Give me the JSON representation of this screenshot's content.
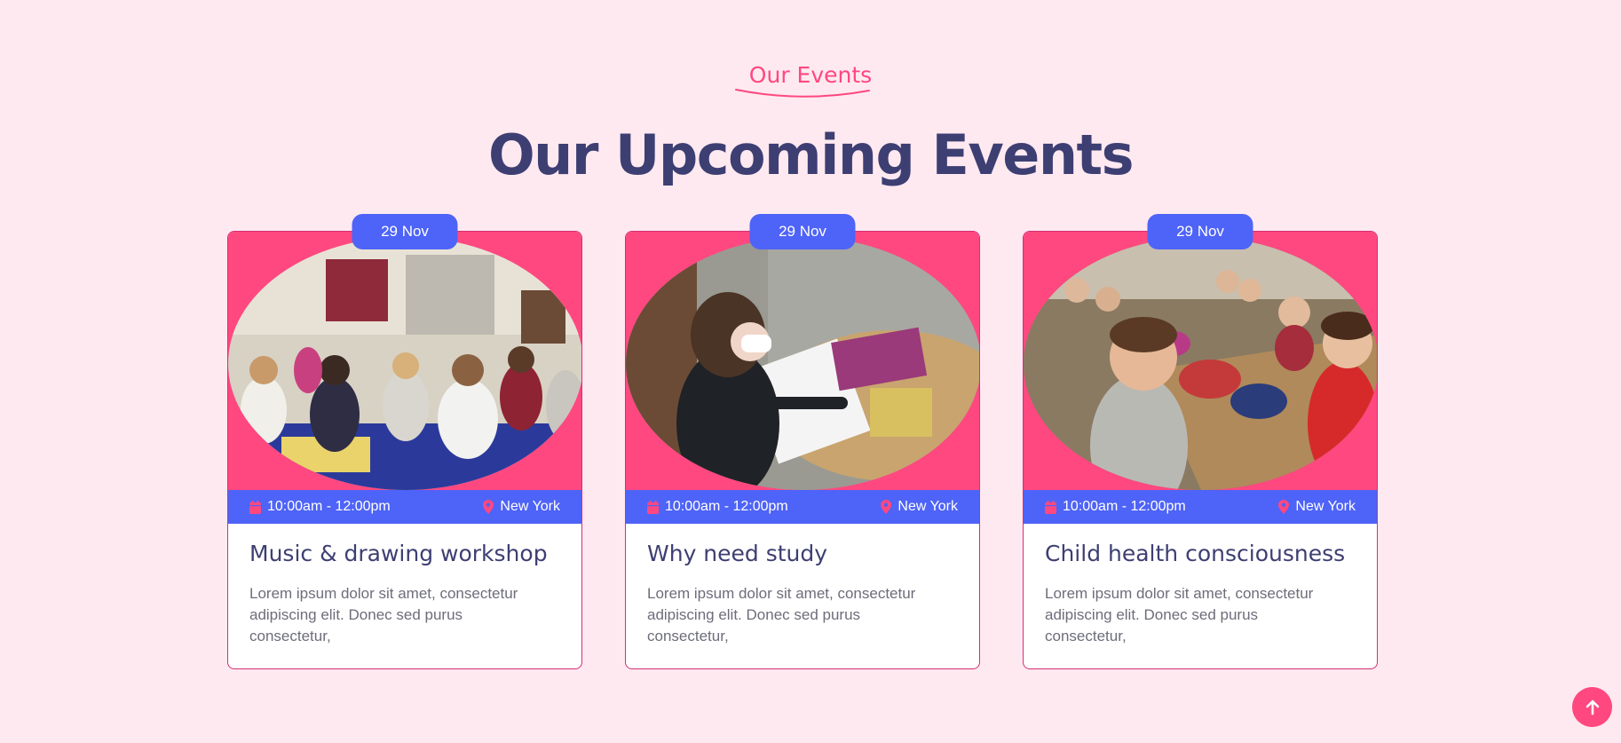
{
  "header": {
    "tag": "Our Events",
    "title": "Our Upcoming Events"
  },
  "events": [
    {
      "date": "29 Nov",
      "time": "10:00am - 12:00pm",
      "location": "New York",
      "title": "Music & drawing workshop",
      "description": "Lorem ipsum dolor sit amet, consectetur adipiscing elit. Donec sed purus consectetur,"
    },
    {
      "date": "29 Nov",
      "time": "10:00am - 12:00pm",
      "location": "New York",
      "title": "Why need study",
      "description": "Lorem ipsum dolor sit amet, consectetur adipiscing elit. Donec sed purus consectetur,"
    },
    {
      "date": "29 Nov",
      "time": "10:00am - 12:00pm",
      "location": "New York",
      "title": "Child health consciousness",
      "description": "Lorem ipsum dolor sit amet, consectetur adipiscing elit. Donec sed purus consectetur,"
    }
  ],
  "icons": {
    "time": "calendar-icon",
    "location": "map-pin-icon",
    "scroll_top": "arrow-up-icon"
  },
  "colors": {
    "background": "#ffe9f1",
    "accent_pink": "#ff4880",
    "accent_blue": "#4e63f7",
    "title_navy": "#3d3f72"
  }
}
